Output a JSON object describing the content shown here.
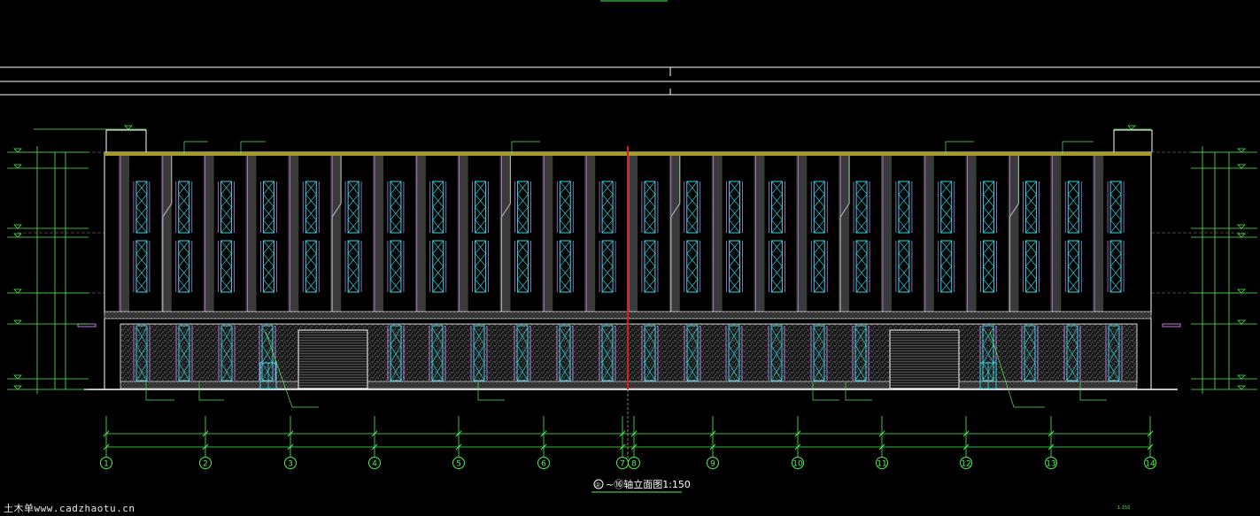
{
  "drawing": {
    "title_index": "①",
    "title_main": "~⑯轴立面图1:150",
    "watermark": "土木单www.cadzhaotu.cn",
    "scale_note": "1:150",
    "axes": [
      "1",
      "2",
      "3",
      "4",
      "5",
      "6",
      "7",
      "8",
      "9",
      "10",
      "11",
      "12",
      "13",
      "14"
    ],
    "colors": {
      "background": "#000000",
      "line": "#ffffff",
      "dimension": "#4ff04f",
      "glazing": "#33d8e8",
      "frame": "#c07ee0",
      "parapet": "#a59a2a",
      "axis_line": "#d42020",
      "stone": "#7a7a7a",
      "pier": "#3a3a3a"
    },
    "icons": [
      "axis-bubble-icon",
      "level-triangle-icon",
      "roller-shutter-door-icon"
    ]
  }
}
